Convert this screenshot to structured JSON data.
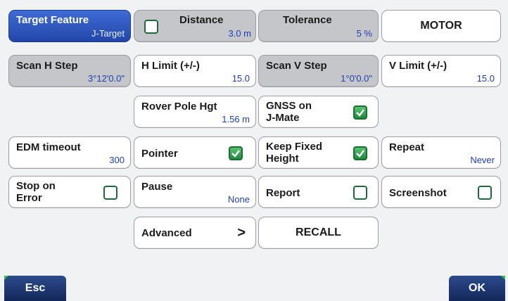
{
  "target_feature": {
    "label": "Target Feature",
    "value": "J-Target"
  },
  "distance": {
    "label": "Distance",
    "value": "3.0 m",
    "checked": false
  },
  "tolerance": {
    "label": "Tolerance",
    "value": "5 %"
  },
  "motor": {
    "label": "MOTOR"
  },
  "scan_h_step": {
    "label": "Scan H Step",
    "value": "3°12'0.0\""
  },
  "h_limit": {
    "label": "H Limit (+/-)",
    "value": "15.0"
  },
  "scan_v_step": {
    "label": "Scan V Step",
    "value": "1°0'0.0\""
  },
  "v_limit": {
    "label": "V Limit (+/-)",
    "value": "15.0"
  },
  "rover_pole": {
    "label": "Rover Pole Hgt",
    "value": "1.56 m"
  },
  "gnss_jmate": {
    "label_line1": "GNSS on",
    "label_line2": "J-Mate",
    "checked": true
  },
  "edm_timeout": {
    "label": "EDM timeout",
    "value": "300"
  },
  "pointer": {
    "label": "Pointer",
    "checked": true
  },
  "keep_fixed_height": {
    "label_line1": "Keep Fixed",
    "label_line2": "Height",
    "checked": true
  },
  "repeat": {
    "label": "Repeat",
    "value": "Never"
  },
  "stop_on_error": {
    "label_line1": "Stop on",
    "label_line2": "Error",
    "checked": false
  },
  "pause": {
    "label": "Pause",
    "value": "None"
  },
  "report": {
    "label": "Report",
    "checked": false
  },
  "screenshot": {
    "label": "Screenshot",
    "checked": false
  },
  "advanced": {
    "label": "Advanced",
    "arrow": ">"
  },
  "recall": {
    "label": "RECALL"
  },
  "softkeys": {
    "esc": "Esc",
    "ok": "OK"
  },
  "colors": {
    "value_blue": "#1f3fb8",
    "check_green": "#2a9a48",
    "softkey_navy": "#1a3370",
    "accent_green": "#2fbf4a"
  }
}
